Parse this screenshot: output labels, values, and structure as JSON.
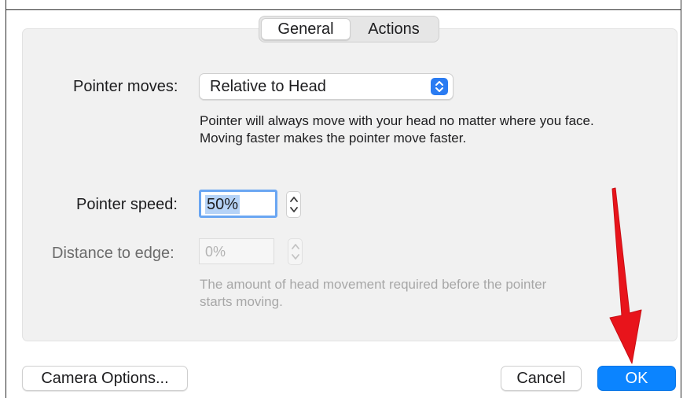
{
  "tabs": [
    {
      "label": "General",
      "selected": true
    },
    {
      "label": "Actions",
      "selected": false
    }
  ],
  "pointer_moves": {
    "label": "Pointer moves:",
    "value": "Relative to Head",
    "description_line1": "Pointer will always move with your head no matter where you face.",
    "description_line2": "Moving faster makes the pointer move faster."
  },
  "pointer_speed": {
    "label": "Pointer speed:",
    "value": "50%"
  },
  "distance_to_edge": {
    "label": "Distance to edge:",
    "value": "0%",
    "enabled": false,
    "description_line1": "The amount of head movement required before the pointer",
    "description_line2": "starts moving."
  },
  "buttons": {
    "camera_options": "Camera Options...",
    "cancel": "Cancel",
    "ok": "OK"
  },
  "annotation": {
    "arrow_color": "#e8141b",
    "arrow_icon": "red-arrow-pointing-at-ok"
  },
  "colors": {
    "accent": "#0b84ff",
    "popup_arrows": "#2b7cf2",
    "focus_ring": "#6aa6f2"
  }
}
